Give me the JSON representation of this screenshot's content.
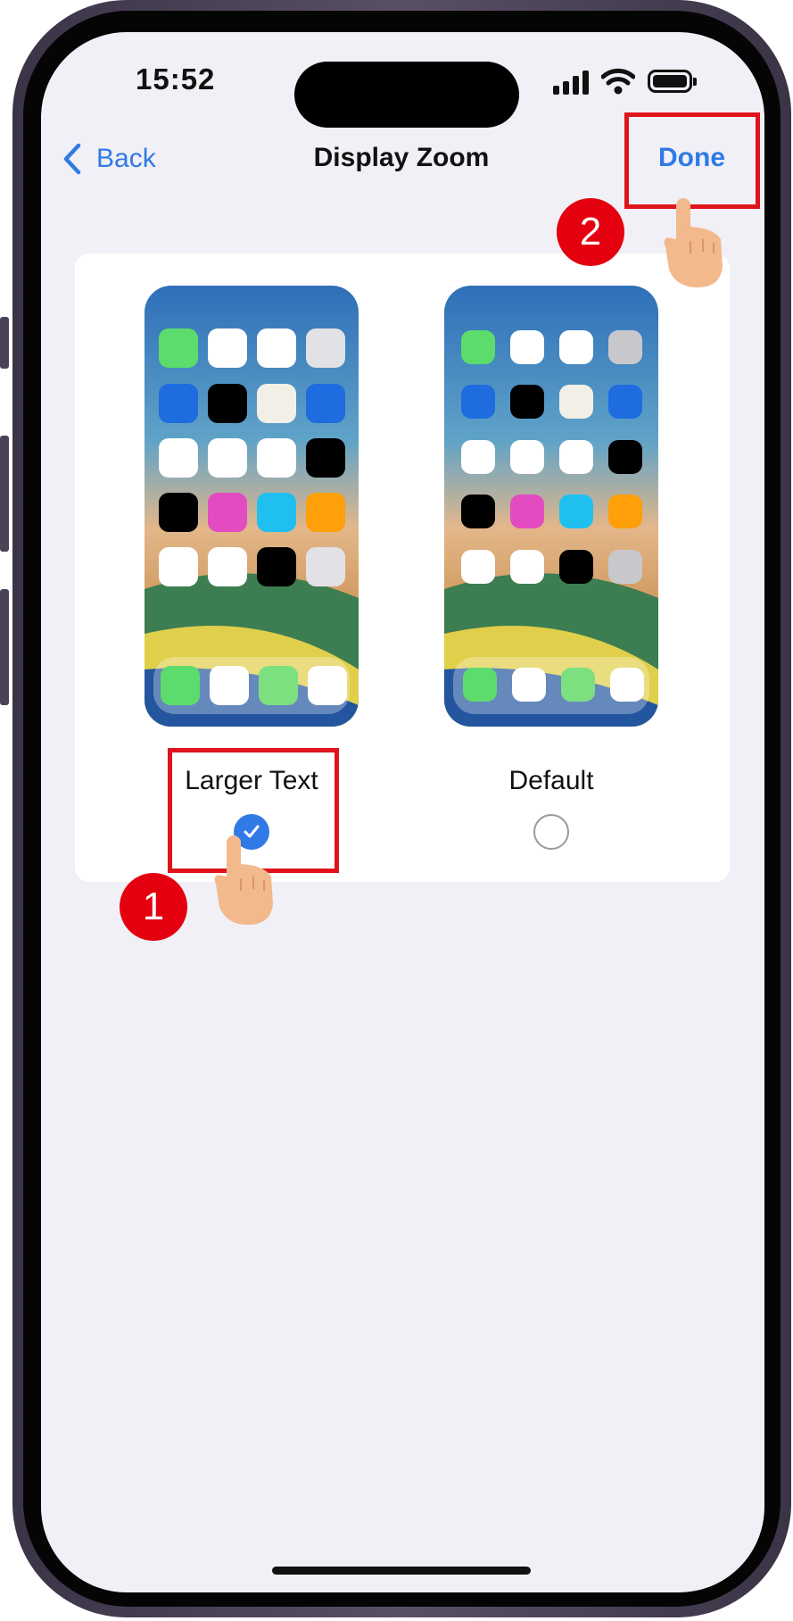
{
  "status_bar": {
    "time": "15:52"
  },
  "nav": {
    "back_label": "Back",
    "title": "Display Zoom",
    "done_label": "Done"
  },
  "options": [
    {
      "label": "Larger Text",
      "selected": true
    },
    {
      "label": "Default",
      "selected": false
    }
  ],
  "steps": [
    "1",
    "2"
  ],
  "colors": {
    "accent": "#2f7ae5",
    "highlight": "#e0141b",
    "badge": "#e4000f"
  }
}
